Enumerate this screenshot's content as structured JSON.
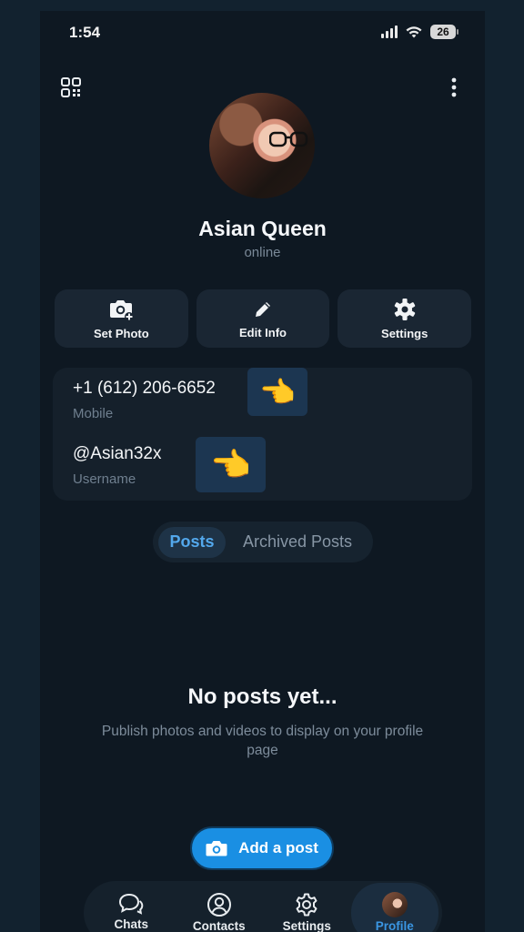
{
  "status_bar": {
    "time": "1:54",
    "battery": "26"
  },
  "profile": {
    "name": "Asian Queen",
    "status": "online"
  },
  "actions": [
    {
      "label": "Set Photo",
      "icon": "camera-add-icon"
    },
    {
      "label": "Edit Info",
      "icon": "pencil-icon"
    },
    {
      "label": "Settings",
      "icon": "gear-icon"
    }
  ],
  "info": {
    "phone": "+1 (612) 206-6652",
    "phone_label": "Mobile",
    "username": "@Asian32x",
    "username_label": "Username",
    "emoji": "👈"
  },
  "tabs": {
    "posts": "Posts",
    "archived": "Archived Posts",
    "active": "Posts"
  },
  "empty_state": {
    "title": "No posts yet...",
    "subtitle": "Publish photos and videos to display on your profile page"
  },
  "add_post": {
    "label": "Add a post"
  },
  "nav": [
    {
      "label": "Chats",
      "icon": "chats-icon"
    },
    {
      "label": "Contacts",
      "icon": "contacts-icon"
    },
    {
      "label": "Settings",
      "icon": "settings-icon"
    },
    {
      "label": "Profile",
      "icon": "profile-avatar"
    }
  ],
  "colors": {
    "accent": "#1a8fe3",
    "background": "#0e1822",
    "card": "#1a2633"
  }
}
